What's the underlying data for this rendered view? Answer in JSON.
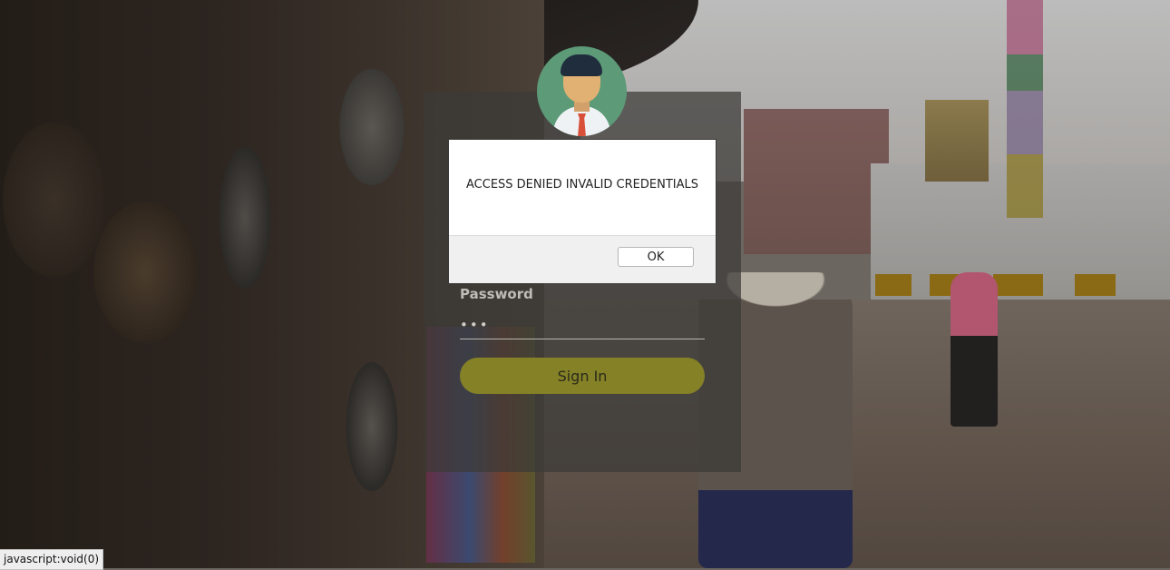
{
  "login": {
    "password_label": "Password",
    "password_value": "•••",
    "signin_label": "Sign In"
  },
  "alert": {
    "message": "ACCESS DENIED INVALID CREDENTIALS",
    "ok_label": "OK"
  },
  "status_bar": {
    "text": "javascript:void(0)"
  },
  "colors": {
    "signin_button": "#858127",
    "avatar_bg": "#5d9a78"
  },
  "icons": {
    "avatar": "user-avatar-icon"
  }
}
